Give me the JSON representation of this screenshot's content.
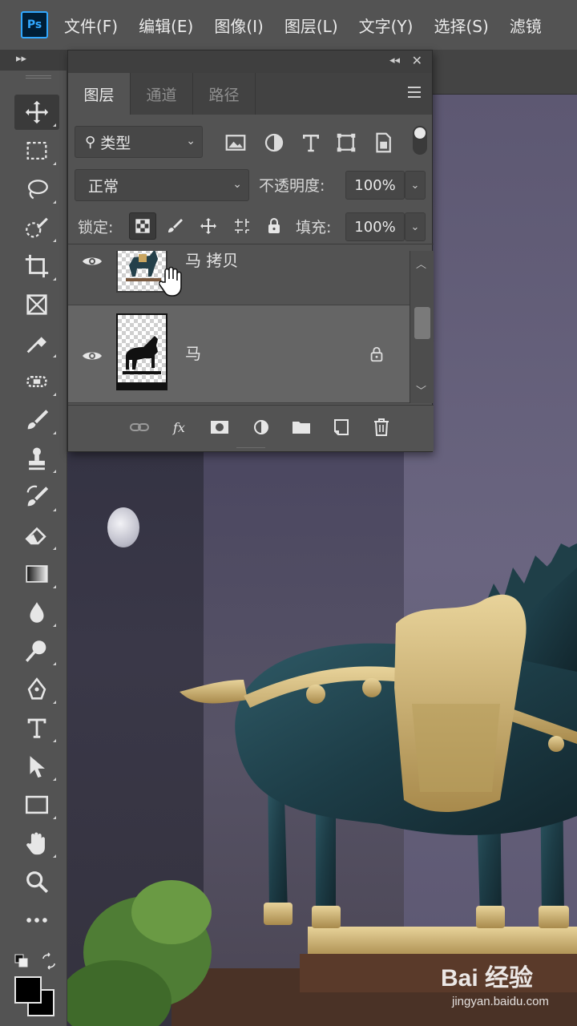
{
  "app": {
    "logo_text": "Ps"
  },
  "menu": [
    "文件(F)",
    "编辑(E)",
    "图像(I)",
    "图层(L)",
    "文字(Y)",
    "选择(S)",
    "滤镜"
  ],
  "tools": [
    {
      "name": "move-tool",
      "icon": "move-icon",
      "active": true
    },
    {
      "name": "marquee-tool",
      "icon": "rect-marquee-icon"
    },
    {
      "name": "lasso-tool",
      "icon": "lasso-icon"
    },
    {
      "name": "quick-selection-tool",
      "icon": "quick-selection-icon"
    },
    {
      "name": "crop-tool",
      "icon": "crop-icon"
    },
    {
      "name": "frame-tool",
      "icon": "frame-icon"
    },
    {
      "name": "eyedropper-tool",
      "icon": "eyedropper-icon"
    },
    {
      "name": "healing-brush-tool",
      "icon": "bandage-icon"
    },
    {
      "name": "brush-tool",
      "icon": "brush-icon"
    },
    {
      "name": "clone-stamp-tool",
      "icon": "stamp-icon"
    },
    {
      "name": "history-brush-tool",
      "icon": "history-brush-icon"
    },
    {
      "name": "eraser-tool",
      "icon": "eraser-icon"
    },
    {
      "name": "gradient-tool",
      "icon": "gradient-icon"
    },
    {
      "name": "blur-tool",
      "icon": "drop-icon"
    },
    {
      "name": "dodge-tool",
      "icon": "dodge-icon"
    },
    {
      "name": "pen-tool",
      "icon": "pen-icon"
    },
    {
      "name": "type-tool",
      "icon": "type-icon"
    },
    {
      "name": "path-selection-tool",
      "icon": "arrow-icon"
    },
    {
      "name": "rectangle-tool",
      "icon": "rectangle-icon"
    },
    {
      "name": "hand-tool",
      "icon": "hand-icon"
    },
    {
      "name": "zoom-tool",
      "icon": "zoom-icon"
    },
    {
      "name": "edit-toolbar",
      "icon": "more-icon"
    }
  ],
  "colors": {
    "foreground": "#000000",
    "background": "#000000",
    "accent": "#31a8ff"
  },
  "layers_panel": {
    "tabs": [
      "图层",
      "通道",
      "路径"
    ],
    "active_tab": "图层",
    "filter": {
      "label": "类型"
    },
    "blend_mode": "正常",
    "opacity_label": "不透明度:",
    "opacity_value": "100%",
    "lock_label": "锁定:",
    "fill_label": "填充:",
    "fill_value": "100%",
    "layers": [
      {
        "name": "马 拷贝",
        "visible": true,
        "selected": false,
        "locked": false
      },
      {
        "name": "马",
        "visible": true,
        "selected": true,
        "locked": true
      }
    ],
    "footer_icons": [
      "link-icon",
      "fx-icon",
      "mask-icon",
      "adjustment-icon",
      "folder-icon",
      "new-layer-icon",
      "trash-icon"
    ]
  },
  "watermark": {
    "logo": "Bai 经验",
    "url": "jingyan.baidu.com"
  }
}
